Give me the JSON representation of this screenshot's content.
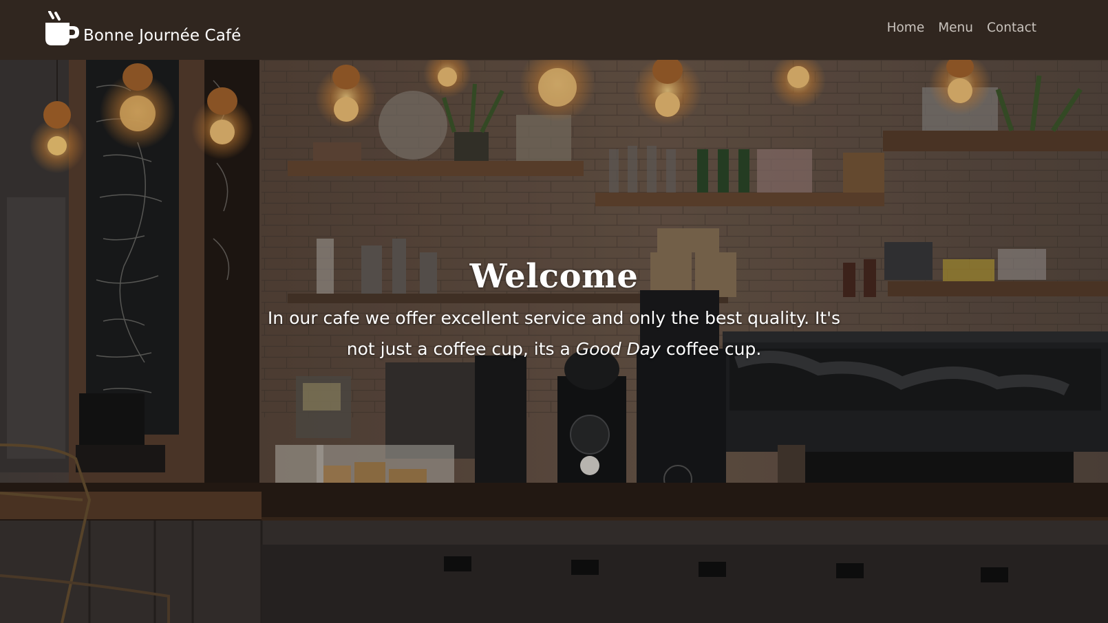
{
  "brand": {
    "name": "Bonne Journée Café",
    "icon": "coffee-cup-icon"
  },
  "nav": {
    "items": [
      {
        "label": "Home"
      },
      {
        "label": "Menu"
      },
      {
        "label": "Contact"
      }
    ]
  },
  "hero": {
    "title": "Welcome",
    "text_before": "In our cafe we offer excellent service and only the best quality. It's not just a coffee cup, its a ",
    "text_emphasis": "Good Day",
    "text_after": " coffee cup.",
    "background": "cafe-counter-photo"
  },
  "colors": {
    "navbar_bg": "#30261f",
    "nav_link": "#c9c3bd",
    "brand_text": "#ffffff",
    "hero_text": "#ffffff"
  }
}
